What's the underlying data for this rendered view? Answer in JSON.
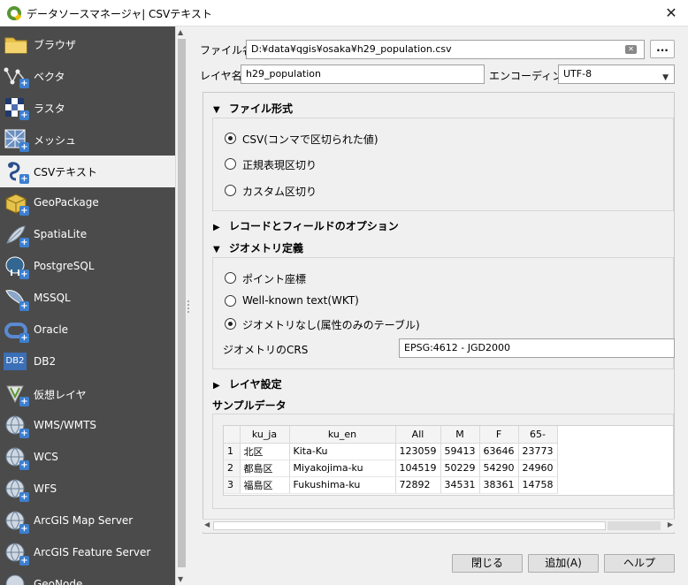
{
  "window": {
    "title": "データソースマネージャ| CSVテキスト",
    "close": "✕"
  },
  "sidebar": {
    "items": [
      {
        "label": "ブラウザ",
        "icon": "folder-icon"
      },
      {
        "label": "ベクタ",
        "icon": "vector-icon"
      },
      {
        "label": "ラスタ",
        "icon": "raster-icon"
      },
      {
        "label": "メッシュ",
        "icon": "mesh-icon"
      },
      {
        "label": "CSVテキスト",
        "icon": "csv-text-icon"
      },
      {
        "label": "GeoPackage",
        "icon": "geopackage-icon"
      },
      {
        "label": "SpatiaLite",
        "icon": "spatialite-icon"
      },
      {
        "label": "PostgreSQL",
        "icon": "postgresql-icon"
      },
      {
        "label": "MSSQL",
        "icon": "mssql-icon"
      },
      {
        "label": "Oracle",
        "icon": "oracle-icon"
      },
      {
        "label": "DB2",
        "icon": "db2-icon"
      },
      {
        "label": "仮想レイヤ",
        "icon": "virtual-layer-icon"
      },
      {
        "label": "WMS/WMTS",
        "icon": "wms-icon"
      },
      {
        "label": "WCS",
        "icon": "wcs-icon"
      },
      {
        "label": "WFS",
        "icon": "wfs-icon"
      },
      {
        "label": "ArcGIS Map Server",
        "icon": "arcgis-map-icon"
      },
      {
        "label": "ArcGIS Feature Server",
        "icon": "arcgis-feature-icon"
      },
      {
        "label": "GeoNode",
        "icon": "geonode-icon"
      }
    ],
    "selected": "CSVテキスト",
    "db2_badge": "DB2"
  },
  "form": {
    "file_label": "ファイル名",
    "file_value": "D:¥data¥qgis¥osaka¥h29_population.csv",
    "browse_label": "...",
    "layer_label": "レイヤ名",
    "layer_value": "h29_population",
    "encoding_label": "エンコーディング",
    "encoding_value": "UTF-8"
  },
  "sections": {
    "file_format": {
      "title": "ファイル形式",
      "options": [
        "CSV(コンマで区切られた値)",
        "正規表現区切り",
        "カスタム区切り"
      ],
      "selected": 0
    },
    "record_options": {
      "title": "レコードとフィールドのオプション"
    },
    "geometry": {
      "title": "ジオメトリ定義",
      "options": [
        "ポイント座標",
        "Well-known text(WKT)",
        "ジオメトリなし(属性のみのテーブル)"
      ],
      "selected": 2,
      "crs_label": "ジオメトリのCRS",
      "crs_value": "EPSG:4612 - JGD2000"
    },
    "layer_settings": {
      "title": "レイヤ設定"
    },
    "sample": {
      "title": "サンプルデータ"
    }
  },
  "sample_table": {
    "columns": [
      "ku_ja",
      "ku_en",
      "All",
      "M",
      "F",
      "65-"
    ],
    "rows": [
      {
        "n": "1",
        "cells": [
          "北区",
          "Kita-Ku",
          "123059",
          "59413",
          "63646",
          "23773"
        ]
      },
      {
        "n": "2",
        "cells": [
          "都島区",
          "Miyakojima-ku",
          "104519",
          "50229",
          "54290",
          "24960"
        ]
      },
      {
        "n": "3",
        "cells": [
          "福島区",
          "Fukushima-ku",
          "72892",
          "34531",
          "38361",
          "14758"
        ]
      }
    ]
  },
  "buttons": {
    "close": "閉じる",
    "add": "追加(A)",
    "help": "ヘルプ"
  },
  "colors": {
    "sidebar_bg": "#4b4b4b",
    "selected_bg": "#f0f0f0",
    "qgis_green": "#589632"
  }
}
